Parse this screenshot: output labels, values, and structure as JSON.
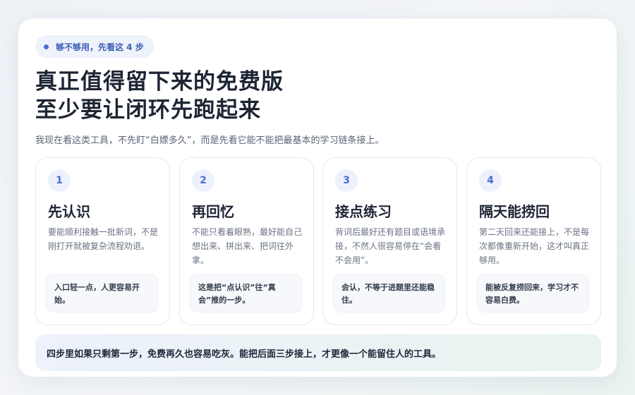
{
  "badge": "够不够用，先看这 4 步",
  "title_line1": "真正值得留下来的免费版",
  "title_line2": "至少要让闭环先跑起来",
  "subtitle": "我现在看这类工具，不先盯“白嫖多久”，而是先看它能不能把最基本的学习链条接上。",
  "steps": [
    {
      "num": "1",
      "title": "先认识",
      "desc": "要能顺利接触一批新词，不是刚打开就被复杂流程劝退。",
      "note": "入口轻一点，人更容易开始。"
    },
    {
      "num": "2",
      "title": "再回忆",
      "desc": "不能只看着眼熟，最好能自己想出来、拼出来、把词往外拿。",
      "note": "这是把“点认识”往“真会”推的一步。"
    },
    {
      "num": "3",
      "title": "接点练习",
      "desc": "背词后最好还有题目或语境承接，不然人很容易停在“会看不会用”。",
      "note": "会认，不等于进题里还能稳住。"
    },
    {
      "num": "4",
      "title": "隔天能捞回",
      "desc": "第二天回来还能接上，不是每次都像重新开始，这才叫真正够用。",
      "note": "能被反复捞回来，学习才不容易白费。"
    }
  ],
  "bottom": "四步里如果只剩第一步，免费再久也容易吃灰。能把后面三步接上，才更像一个能留住人的工具。"
}
